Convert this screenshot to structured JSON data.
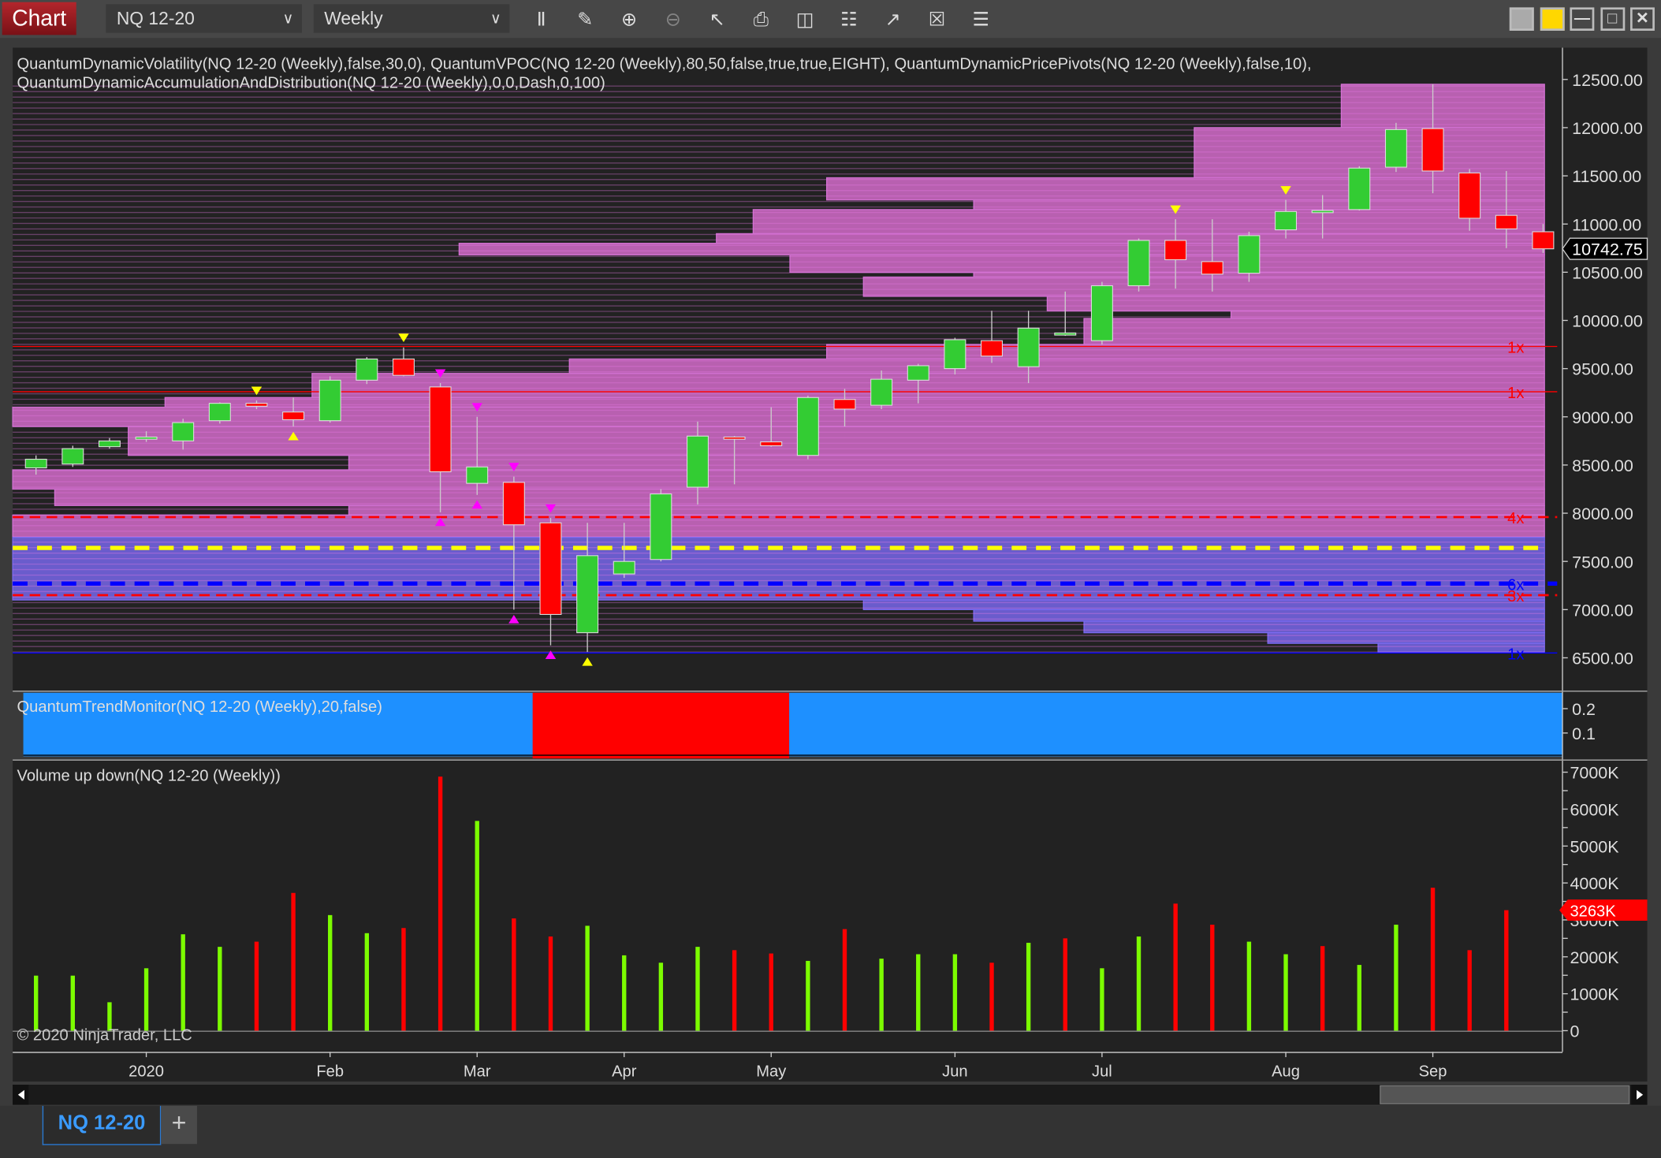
{
  "toolbar": {
    "chart_label": "Chart",
    "instrument": "NQ 12-20",
    "interval": "Weekly",
    "tools": [
      "bar-chart-icon",
      "pencil-icon",
      "zoom-in-icon",
      "zoom-out-icon",
      "pointer-icon",
      "data-box-icon",
      "properties-icon",
      "indicators-icon",
      "strategies-icon",
      "drawing-objects-icon",
      "list-icon"
    ],
    "window_buttons": [
      "gray-color-button",
      "yellow-link-button",
      "minimize-button",
      "maximize-button",
      "close-button"
    ]
  },
  "indicators_label_1": "QuantumDynamicVolatility(NQ 12-20 (Weekly),false,30,0), QuantumVPOC(NQ 12-20 (Weekly),80,50,false,true,true,EIGHT), QuantumDynamicPricePivots(NQ 12-20 (Weekly),false,10),",
  "indicators_label_2": "QuantumDynamicAccumulationAndDistribution(NQ 12-20 (Weekly),0,0,Dash,0,100)",
  "trend_label": "QuantumTrendMonitor(NQ 12-20 (Weekly),20,false)",
  "volume_label": "Volume up down(NQ 12-20 (Weekly))",
  "copyright": "© 2020 NinjaTrader, LLC",
  "tab": {
    "label": "NQ 12-20",
    "add": "+"
  },
  "colors": {
    "up": "#33cc33",
    "down": "#ff0000",
    "profile": "#b860b0",
    "profile_low": "#6a5ccc",
    "trend_up": "#1e90ff",
    "trend_down": "#ff0000",
    "vol_up": "#7cfc00",
    "vol_down": "#ff0000"
  },
  "chart_data": [
    {
      "type": "candlestick",
      "ylim": [
        6400,
        12700
      ],
      "yticks": [
        "12500.00",
        "12000.00",
        "11500.00",
        "11000.00",
        "10500.00",
        "10000.00",
        "9500.00",
        "9000.00",
        "8500.00",
        "8000.00",
        "7500.00",
        "7000.00",
        "6500.00"
      ],
      "ytick_values": [
        12500,
        12000,
        11500,
        11000,
        10500,
        10000,
        9500,
        9000,
        8500,
        8000,
        7500,
        7000,
        6500
      ],
      "last_price": "10742.75",
      "last_price_value": 10742.75,
      "xlabels": [
        {
          "i": 3,
          "label": "2020"
        },
        {
          "i": 8,
          "label": "Feb"
        },
        {
          "i": 12,
          "label": "Mar"
        },
        {
          "i": 16,
          "label": "Apr"
        },
        {
          "i": 20,
          "label": "May"
        },
        {
          "i": 25,
          "label": "Jun"
        },
        {
          "i": 29,
          "label": "Jul"
        },
        {
          "i": 34,
          "label": "Aug"
        },
        {
          "i": 38,
          "label": "Sep"
        }
      ],
      "ohlc": [
        [
          8470,
          8600,
          8400,
          8560
        ],
        [
          8510,
          8700,
          8480,
          8670
        ],
        [
          8690,
          8780,
          8670,
          8750
        ],
        [
          8770,
          8850,
          8740,
          8790
        ],
        [
          8750,
          8980,
          8660,
          8940
        ],
        [
          8960,
          9150,
          8930,
          9140
        ],
        [
          9140,
          9170,
          9080,
          9110
        ],
        [
          9050,
          9200,
          8900,
          8970
        ],
        [
          8960,
          9420,
          8940,
          9380
        ],
        [
          9380,
          9620,
          9340,
          9600
        ],
        [
          9600,
          9720,
          9420,
          9430
        ],
        [
          9310,
          9350,
          8010,
          8430
        ],
        [
          8310,
          9000,
          8190,
          8480
        ],
        [
          8320,
          8380,
          7000,
          7880
        ],
        [
          7900,
          7950,
          6630,
          6950
        ],
        [
          6760,
          7900,
          6560,
          7560
        ],
        [
          7370,
          7900,
          7330,
          7500
        ],
        [
          7520,
          8250,
          7500,
          8200
        ],
        [
          8270,
          8950,
          8090,
          8800
        ],
        [
          8790,
          8800,
          8300,
          8770
        ],
        [
          8740,
          9100,
          8690,
          8700
        ],
        [
          8600,
          9220,
          8560,
          9200
        ],
        [
          9180,
          9290,
          8900,
          9080
        ],
        [
          9120,
          9480,
          9080,
          9390
        ],
        [
          9380,
          9550,
          9140,
          9530
        ],
        [
          9500,
          9820,
          9440,
          9800
        ],
        [
          9790,
          10100,
          9560,
          9630
        ],
        [
          9520,
          10100,
          9350,
          9920
        ],
        [
          9870,
          10300,
          9840,
          9870
        ],
        [
          9790,
          10400,
          9750,
          10360
        ],
        [
          10360,
          10850,
          10300,
          10830
        ],
        [
          10830,
          11050,
          10330,
          10630
        ],
        [
          10610,
          11050,
          10300,
          10480
        ],
        [
          10490,
          10920,
          10400,
          10880
        ],
        [
          10940,
          11250,
          10850,
          11130
        ],
        [
          11140,
          11300,
          10850,
          11140
        ],
        [
          11150,
          11600,
          11140,
          11580
        ],
        [
          11590,
          12050,
          11540,
          11980
        ],
        [
          11990,
          12450,
          11320,
          11550
        ],
        [
          11530,
          11570,
          10930,
          11060
        ],
        [
          11090,
          11550,
          10750,
          10950
        ],
        [
          10920,
          11000,
          10700,
          10742.75
        ]
      ],
      "volume_profile": [
        [
          12000,
          12450,
          36
        ],
        [
          11480,
          12000,
          32
        ],
        [
          11250,
          11480,
          22
        ],
        [
          11150,
          11250,
          26
        ],
        [
          10900,
          11150,
          20
        ],
        [
          10800,
          10900,
          19
        ],
        [
          10680,
          10800,
          12
        ],
        [
          10500,
          10680,
          21
        ],
        [
          10450,
          10500,
          26
        ],
        [
          10250,
          10450,
          23
        ],
        [
          10100,
          10250,
          28
        ],
        [
          10020,
          10100,
          33
        ],
        [
          9750,
          10020,
          29
        ],
        [
          9600,
          9750,
          22
        ],
        [
          9450,
          9600,
          15
        ],
        [
          9200,
          9450,
          8
        ],
        [
          9100,
          9200,
          4
        ],
        [
          8900,
          9100,
          0
        ],
        [
          8600,
          8900,
          3
        ],
        [
          8450,
          8600,
          9
        ],
        [
          8250,
          8450,
          0
        ],
        [
          8080,
          8250,
          1
        ],
        [
          7980,
          8080,
          9
        ],
        [
          7750,
          7980,
          0
        ]
      ],
      "volume_profile_low": [
        [
          7100,
          7750,
          0
        ],
        [
          7000,
          7100,
          23
        ],
        [
          6880,
          7000,
          26
        ],
        [
          6760,
          6880,
          29
        ],
        [
          6650,
          6760,
          34
        ],
        [
          6560,
          6650,
          37
        ]
      ],
      "levels": [
        {
          "price": 9730,
          "label": "1x",
          "color": "#ff0000",
          "style": "thin"
        },
        {
          "price": 9260,
          "label": "1x",
          "color": "#ff0000",
          "style": "thin"
        },
        {
          "price": 7960,
          "label": "4x",
          "color": "#ff0000",
          "style": "dash"
        },
        {
          "price": 7640,
          "label": "",
          "color": "#ffff00",
          "style": "thick-dash"
        },
        {
          "price": 7270,
          "label": "6x",
          "color": "#0000ff",
          "style": "thick-dash"
        },
        {
          "price": 7150,
          "label": "3x",
          "color": "#ff0000",
          "style": "dash"
        },
        {
          "price": 6550,
          "label": "1x",
          "color": "#0000ff",
          "style": "thin"
        }
      ],
      "markers": [
        {
          "i": 6,
          "type": "down",
          "color": "#ffff00"
        },
        {
          "i": 7,
          "type": "up",
          "color": "#ffff00"
        },
        {
          "i": 10,
          "type": "down",
          "color": "#ffff00"
        },
        {
          "i": 11,
          "type": "up",
          "color": "#ff00ff"
        },
        {
          "i": 11,
          "type": "down",
          "color": "#ff00ff"
        },
        {
          "i": 12,
          "type": "up",
          "color": "#ff00ff"
        },
        {
          "i": 12,
          "type": "down",
          "color": "#ff00ff"
        },
        {
          "i": 13,
          "type": "up",
          "color": "#ff00ff"
        },
        {
          "i": 13,
          "type": "down",
          "color": "#ff00ff"
        },
        {
          "i": 14,
          "type": "up",
          "color": "#ff00ff"
        },
        {
          "i": 14,
          "type": "down",
          "color": "#ff00ff"
        },
        {
          "i": 15,
          "type": "up",
          "color": "#ffff00"
        },
        {
          "i": 31,
          "type": "down",
          "color": "#ffff00"
        },
        {
          "i": 34,
          "type": "down",
          "color": "#ffff00"
        }
      ]
    },
    {
      "type": "trend",
      "yticks": [
        "0.2",
        "0.1"
      ],
      "down_range": [
        14,
        20
      ]
    },
    {
      "type": "bar",
      "ylim": [
        0,
        7000
      ],
      "yticks": [
        "7000K",
        "6000K",
        "5000K",
        "4000K",
        "3000K",
        "2000K",
        "1000K",
        "0"
      ],
      "ytick_values": [
        7000,
        6000,
        5000,
        4000,
        3000,
        2000,
        1000,
        0
      ],
      "last_volume": "3263K",
      "last_volume_value": 3263,
      "values": [
        1490,
        1490,
        770,
        1690,
        2610,
        2270,
        2410,
        3730,
        3130,
        2640,
        2780,
        6880,
        5680,
        3040,
        2550,
        2840,
        2040,
        1840,
        2270,
        2180,
        2090,
        1890,
        2750,
        1950,
        2070,
        2070,
        1840,
        2380,
        2500,
        1690,
        2550,
        3440,
        2870,
        2410,
        2070,
        2290,
        1780,
        2870,
        3870,
        2180,
        3263
      ],
      "up": [
        1,
        1,
        1,
        1,
        1,
        1,
        0,
        0,
        1,
        1,
        0,
        0,
        1,
        0,
        0,
        1,
        1,
        1,
        1,
        0,
        0,
        1,
        0,
        1,
        1,
        1,
        0,
        1,
        0,
        1,
        1,
        0,
        0,
        1,
        1,
        0,
        1,
        1,
        0,
        0,
        0
      ]
    }
  ]
}
